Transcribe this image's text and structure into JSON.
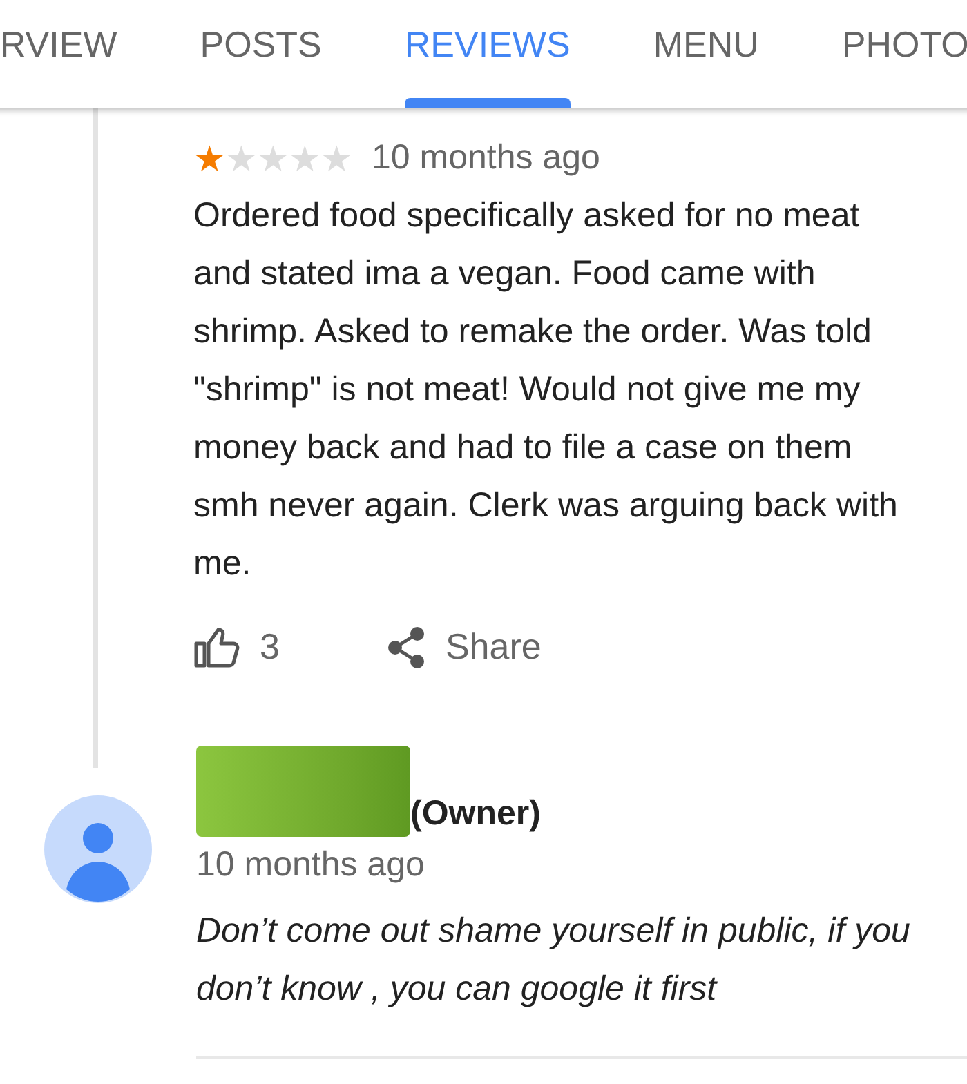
{
  "tabs": [
    {
      "label": "RVIEW",
      "selected": false
    },
    {
      "label": "POSTS",
      "selected": false
    },
    {
      "label": "REVIEWS",
      "selected": true
    },
    {
      "label": "MENU",
      "selected": false
    },
    {
      "label": "PHOTO",
      "selected": false
    }
  ],
  "review": {
    "stars": 1,
    "time": "10 months ago",
    "text": "Ordered food specifically asked for no meat and stated ima a vegan. Food came with shrimp. Asked to remake the order. Was told \"shrimp\" is not meat! Would not give me my money back and had to file a case on them smh never again. Clerk was arguing back with me.",
    "likes": "3",
    "share": "Share"
  },
  "owner_reply": {
    "role": "(Owner)",
    "time": "10 months ago",
    "text": "Don’t come out shame yourself in public, if you don’t know , you can google it first"
  }
}
